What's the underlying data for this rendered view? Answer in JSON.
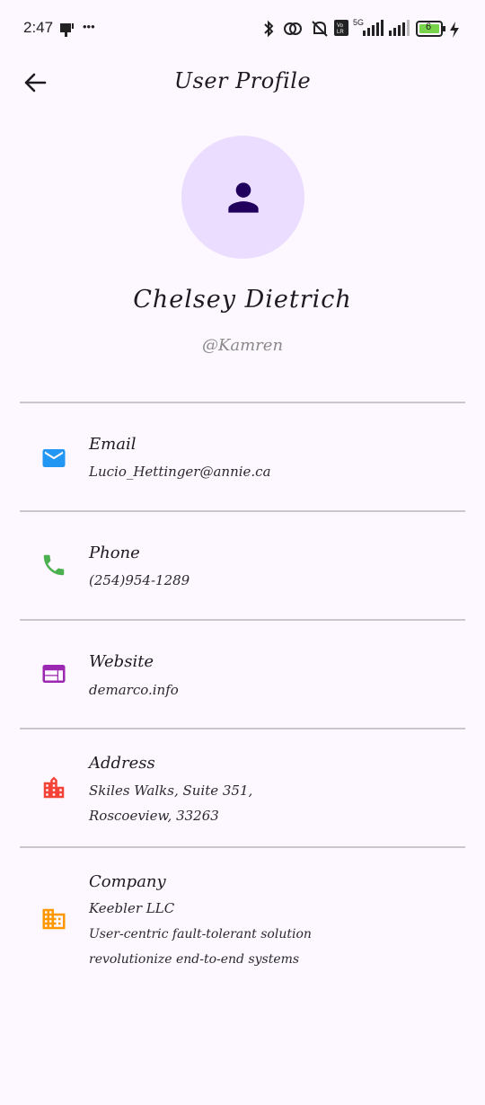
{
  "status_bar": {
    "time": "2:47",
    "overflow": "•••",
    "network": "5G",
    "battery": "6"
  },
  "app_bar": {
    "back_icon": "arrow-back-icon",
    "title": "User  Profile"
  },
  "profile": {
    "avatar_icon": "person-icon",
    "name": "Chelsey  Dietrich",
    "username": "@Kamren"
  },
  "info": {
    "email": {
      "label": "Email",
      "value": "Lucio_Hettinger@annie.ca",
      "icon": "email-icon",
      "color": "#2196f3"
    },
    "phone": {
      "label": "Phone",
      "value": "(254)954-1289",
      "icon": "phone-icon",
      "color": "#4caf50"
    },
    "website": {
      "label": "Website",
      "value": "demarco.info",
      "icon": "web-icon",
      "color": "#9c27b0"
    },
    "address": {
      "label": "Address",
      "line1": "Skiles  Walks,  Suite  351,",
      "line2": "Roscoeview,  33263",
      "icon": "location-city-icon",
      "color": "#f44336"
    },
    "company": {
      "label": "Company",
      "name": "Keebler  LLC",
      "catch_phrase": "User-centric  fault-tolerant  solution",
      "bs": "revolutionize  end-to-end  systems",
      "icon": "business-icon",
      "color": "#ff9800"
    }
  },
  "colors": {
    "background": "#fdf7ff",
    "avatar_bg": "#eaddff",
    "avatar_fg": "#21005d",
    "divider": "#c9c6cc"
  }
}
